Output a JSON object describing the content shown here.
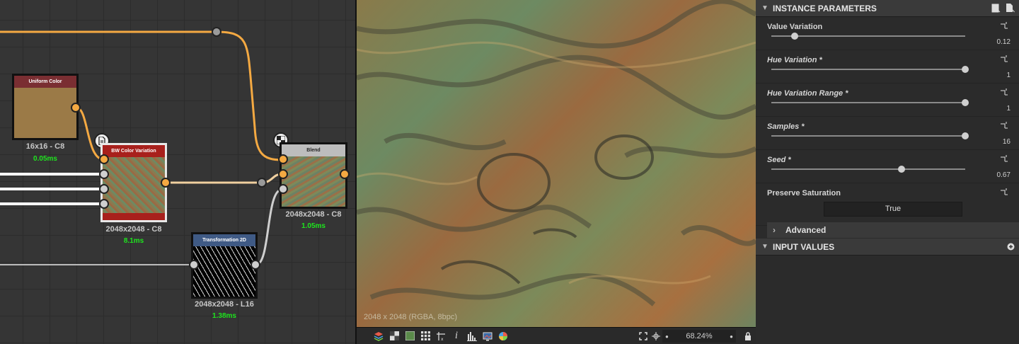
{
  "graph": {
    "nodes": {
      "uniform_color": {
        "title": "Uniform Color",
        "info": "16x16 - C8",
        "time": "0.05ms",
        "header_color": "#7a2e32",
        "swatch_color": "#9b7a47"
      },
      "bw_color_variation": {
        "title": "BW Color Variation",
        "info": "2048x2048 - C8",
        "time": "8.1ms",
        "header_color": "#a8201c"
      },
      "blend": {
        "title": "Blend",
        "info": "2048x2048 - C8",
        "time": "1.05ms",
        "header_color": "#bdbdbd"
      },
      "transformation_2d": {
        "title": "Transformation 2D",
        "info": "2048x2048 - L16",
        "time": "1.38ms",
        "header_color": "#3f5a85"
      }
    },
    "link_color": "#f4a942"
  },
  "viewport": {
    "resolution_label": "2048 x 2048 (RGBA, 8bpc)",
    "zoom": "68.24%",
    "toolbar_icons": [
      "layers-icon",
      "checker-icon",
      "color-swatch-icon",
      "grid-icon",
      "tiling-icon",
      "info-icon",
      "histogram-icon",
      "screenshot-icon",
      "color-wheel-icon"
    ]
  },
  "properties": {
    "instance_header": "INSTANCE PARAMETERS",
    "params": [
      {
        "label": "Value Variation",
        "value": "0.12",
        "fraction": 0.12,
        "italic": false
      },
      {
        "label": "Hue Variation *",
        "value": "1",
        "fraction": 1,
        "italic": true
      },
      {
        "label": "Hue Variation Range *",
        "value": "1",
        "fraction": 1,
        "italic": true
      },
      {
        "label": "Samples *",
        "value": "16",
        "fraction": 1,
        "italic": true
      },
      {
        "label": "Seed *",
        "value": "0.67",
        "fraction": 0.67,
        "italic": true
      }
    ],
    "preserve_saturation": {
      "label": "Preserve Saturation",
      "value": "True"
    },
    "advanced_label": "Advanced",
    "input_values_header": "INPUT VALUES"
  }
}
